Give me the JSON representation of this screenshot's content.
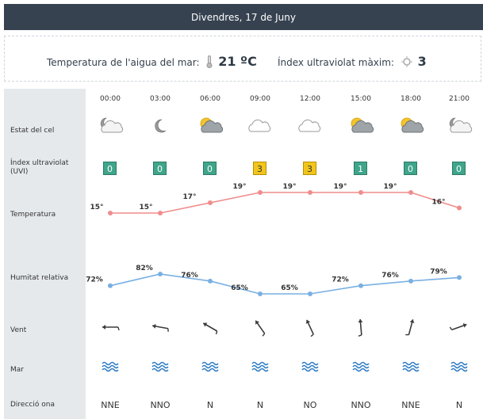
{
  "header": {
    "title": "Divendres, 17 de Juny"
  },
  "summary": {
    "water_label": "Temperatura de l'aigua del mar:",
    "water_value": "21 ºC",
    "uv_label": "Índex ultraviolat màxim:",
    "uv_value": "3"
  },
  "labels": {
    "sky": "Estat del cel",
    "uvi": "Índex ultraviolat (UVI)",
    "temperature": "Temperatura",
    "humidity": "Humitat relativa",
    "wind": "Vent",
    "sea": "Mar",
    "wave_dir": "Direcció ona"
  },
  "times": [
    "00:00",
    "03:00",
    "06:00",
    "09:00",
    "12:00",
    "15:00",
    "18:00",
    "21:00"
  ],
  "sky_icons": [
    "cloud-moon-icon",
    "moon-icon",
    "sun-cloud-icon",
    "cloud-icon",
    "cloud-icon",
    "sun-cloud-icon",
    "sun-cloud-icon",
    "cloud-moon-icon"
  ],
  "uvi": [
    "0",
    "0",
    "0",
    "3",
    "3",
    "1",
    "0",
    "0"
  ],
  "temperature": {
    "values": [
      15,
      15,
      17,
      19,
      19,
      19,
      19,
      16
    ],
    "labels": [
      "15°",
      "15°",
      "17°",
      "19°",
      "19°",
      "19°",
      "19°",
      "16°"
    ]
  },
  "humidity": {
    "values": [
      72,
      82,
      76,
      65,
      65,
      72,
      76,
      79
    ],
    "labels": [
      "72%",
      "82%",
      "76%",
      "65%",
      "65%",
      "72%",
      "76%",
      "79%"
    ]
  },
  "wind_icons": [
    "arrow-icon",
    "arrow-icon",
    "arrow-icon",
    "arrow-icon",
    "arrow-icon",
    "arrow-icon",
    "arrow-icon",
    "arrow-icon"
  ],
  "sea_icons": [
    "waves-icon",
    "waves-icon",
    "waves-icon",
    "waves-icon",
    "waves-icon",
    "waves-icon",
    "waves-icon",
    "waves-icon"
  ],
  "wave_dirs": [
    "NNE",
    "NNO",
    "N",
    "N",
    "NO",
    "NNO",
    "NNE",
    "N"
  ],
  "colors": {
    "header_bg": "#364250",
    "uv_green": "#3fa58b",
    "uv_yellow": "#f2c51c",
    "temp_line": "#f08c8c",
    "hum_line": "#79b0e2",
    "sea_waves": "#2d7cc4"
  }
}
